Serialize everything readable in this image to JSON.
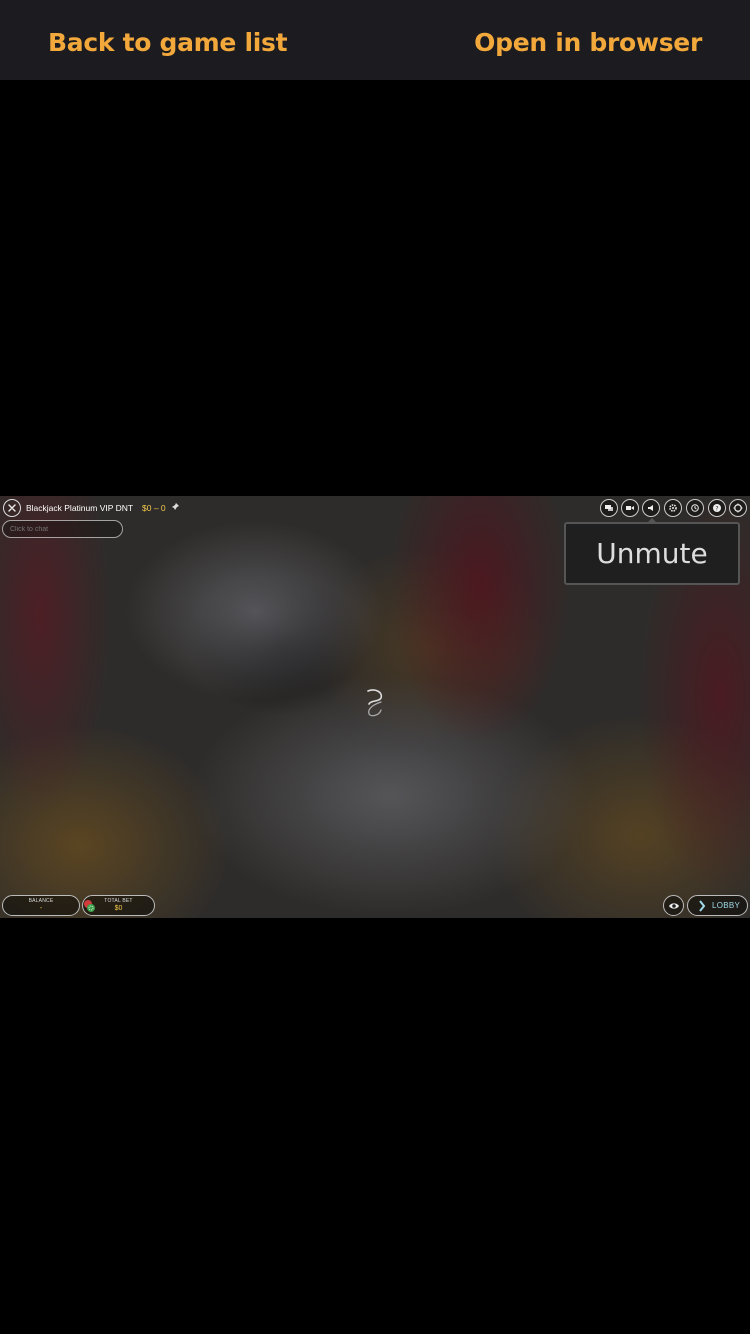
{
  "topbar": {
    "back_label": "Back to game list",
    "open_label": "Open in browser",
    "link_color": "#f2a83b"
  },
  "game": {
    "title": "Blackjack Platinum VIP DNT",
    "limits": "$0 – 0",
    "chat_placeholder": "Click to chat",
    "tooltip": "Unmute",
    "toolbar_icons": [
      "chat-icon",
      "video-icon",
      "sound-icon",
      "settings-icon",
      "history-icon",
      "help-icon",
      "fullscreen-icon"
    ],
    "balance_label": "BALANCE",
    "balance_value": "-",
    "totalbet_label": "TOTAL BET",
    "totalbet_value": "$0",
    "lobby_label": "LOBBY",
    "accent_color": "#f2c84b"
  }
}
